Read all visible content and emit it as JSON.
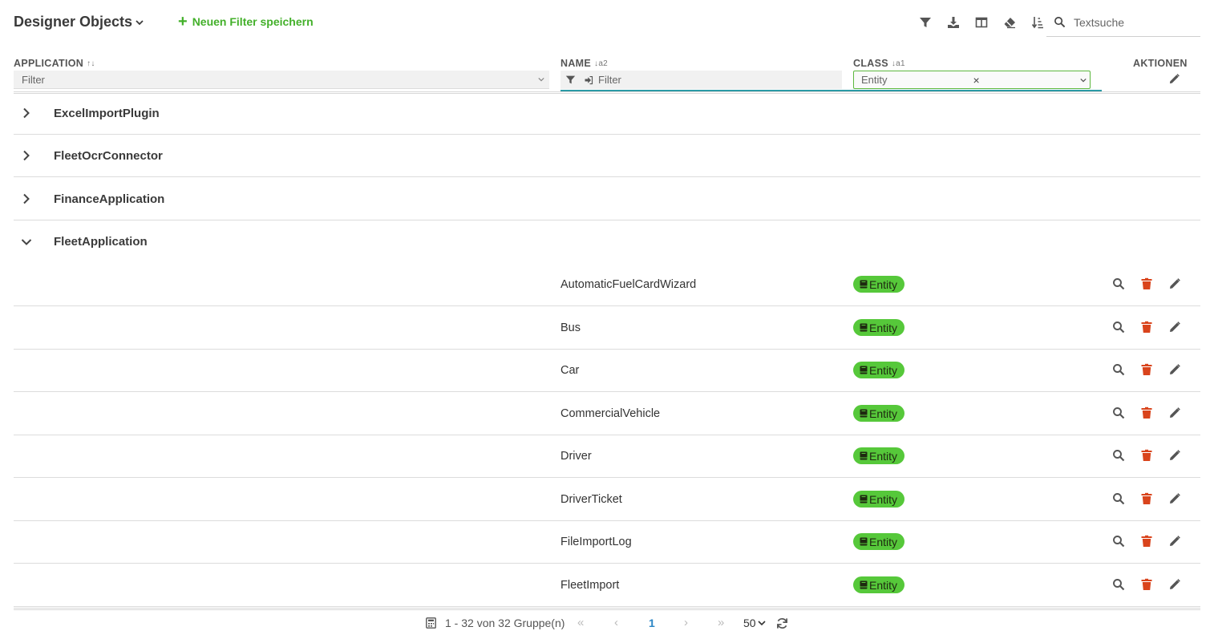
{
  "header": {
    "title": "Designer Objects",
    "new_filter_label": "Neuen Filter speichern",
    "search_placeholder": "Textsuche"
  },
  "toolbar": {
    "icons": [
      "filter-icon",
      "download-icon",
      "columns-icon",
      "eraser-icon",
      "sort-icon"
    ]
  },
  "columns": {
    "application": {
      "label": "APPLICATION",
      "sort": "↑↓",
      "filter_placeholder": "Filter"
    },
    "name": {
      "label": "NAME",
      "sort": "↓a2",
      "filter_placeholder": "Filter"
    },
    "class": {
      "label": "CLASS",
      "sort": "↓a1",
      "filter_value": "Entity"
    },
    "actions": {
      "label": "AKTIONEN"
    }
  },
  "groups": [
    {
      "name": "ExcelImportPlugin",
      "expanded": false
    },
    {
      "name": "FleetOcrConnector",
      "expanded": false
    },
    {
      "name": "FinanceApplication",
      "expanded": false
    },
    {
      "name": "FleetApplication",
      "expanded": true
    }
  ],
  "rows": [
    {
      "name": "AutomaticFuelCardWizard",
      "class": "Entity"
    },
    {
      "name": "Bus",
      "class": "Entity"
    },
    {
      "name": "Car",
      "class": "Entity"
    },
    {
      "name": "CommercialVehicle",
      "class": "Entity"
    },
    {
      "name": "Driver",
      "class": "Entity"
    },
    {
      "name": "DriverTicket",
      "class": "Entity"
    },
    {
      "name": "FileImportLog",
      "class": "Entity"
    },
    {
      "name": "FleetImport",
      "class": "Entity"
    }
  ],
  "footer": {
    "range_text": "1 - 32 von 32 Gruppe(n)",
    "current_page": "1",
    "page_size": "50",
    "first_glyph": "«",
    "prev_glyph": "‹",
    "next_glyph": "›",
    "last_glyph": "»"
  },
  "colors": {
    "accent_green": "#43b02a",
    "badge_green": "#56c83a",
    "delete_red": "#d9441c",
    "page_blue": "#2b86c5",
    "underline_teal": "#2b9aa6"
  }
}
